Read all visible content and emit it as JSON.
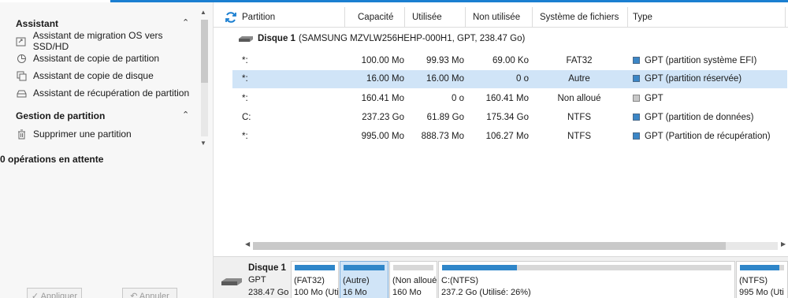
{
  "sidebar": {
    "sections": [
      {
        "title": "Assistant",
        "items": [
          {
            "label": "Assistant de migration OS vers SSD/HD",
            "icon": "migrate-icon"
          },
          {
            "label": "Assistant de copie de partition",
            "icon": "copy-partition-icon"
          },
          {
            "label": "Assistant de copie de disque",
            "icon": "copy-disk-icon"
          },
          {
            "label": "Assistant de récupération de partition",
            "icon": "recover-icon"
          }
        ]
      },
      {
        "title": "Gestion de partition",
        "items": [
          {
            "label": "Supprimer une partition",
            "icon": "trash-icon"
          }
        ]
      }
    ],
    "pending": "0 opérations en attente",
    "apply_label": "✓ Appliquer",
    "undo_label": "↶ Annuler"
  },
  "table": {
    "columns": [
      "Partition",
      "Capacité",
      "Utilisée",
      "Non utilisée",
      "Système de fichiers",
      "Type"
    ],
    "disk": {
      "name": "Disque 1",
      "detail": "(SAMSUNG MZVLW256HEHP-000H1, GPT, 238.47 Go)"
    },
    "rows": [
      {
        "partition": "*:",
        "capacity": "100.00 Mo",
        "used": "99.93 Mo",
        "unused": "69.00 Ko",
        "fs": "FAT32",
        "type": "GPT (partition système EFI)",
        "color": "#3b86c6",
        "selected": false
      },
      {
        "partition": "*:",
        "capacity": "16.00 Mo",
        "used": "16.00 Mo",
        "unused": "0 o",
        "fs": "Autre",
        "type": "GPT (partition réservée)",
        "color": "#3b86c6",
        "selected": true
      },
      {
        "partition": "*:",
        "capacity": "160.41 Mo",
        "used": "0 o",
        "unused": "160.41 Mo",
        "fs": "Non alloué",
        "type": "GPT",
        "color": "#c8c8c8",
        "selected": false
      },
      {
        "partition": "C:",
        "capacity": "237.23 Go",
        "used": "61.89 Go",
        "unused": "175.34 Go",
        "fs": "NTFS",
        "type": "GPT (partition de données)",
        "color": "#3b86c6",
        "selected": false
      },
      {
        "partition": "*:",
        "capacity": "995.00 Mo",
        "used": "888.73 Mo",
        "unused": "106.27 Mo",
        "fs": "NTFS",
        "type": "GPT (Partition de récupération)",
        "color": "#3b86c6",
        "selected": false
      }
    ]
  },
  "diskmap": {
    "name": "Disque 1",
    "type": "GPT",
    "size": "238.47 Go",
    "blocks": [
      {
        "l1": "(FAT32)",
        "l2": "100 Mo (Uti",
        "usage": 1.0,
        "selected": false
      },
      {
        "l1": "(Autre)",
        "l2": "16 Mo",
        "usage": 1.0,
        "selected": true
      },
      {
        "l1": "(Non alloué",
        "l2": "160 Mo",
        "usage": 0.0,
        "selected": false
      },
      {
        "l1": "C:(NTFS)",
        "l2": "237.2 Go (Utilisé: 26%)",
        "usage": 0.26,
        "selected": false
      },
      {
        "l1": "(NTFS)",
        "l2": "995 Mo (Uti",
        "usage": 0.89,
        "selected": false
      }
    ]
  },
  "colors": {
    "accent": "#1b7fd1",
    "selection": "#d0e4f7",
    "partition_blue": "#2f86c9"
  }
}
